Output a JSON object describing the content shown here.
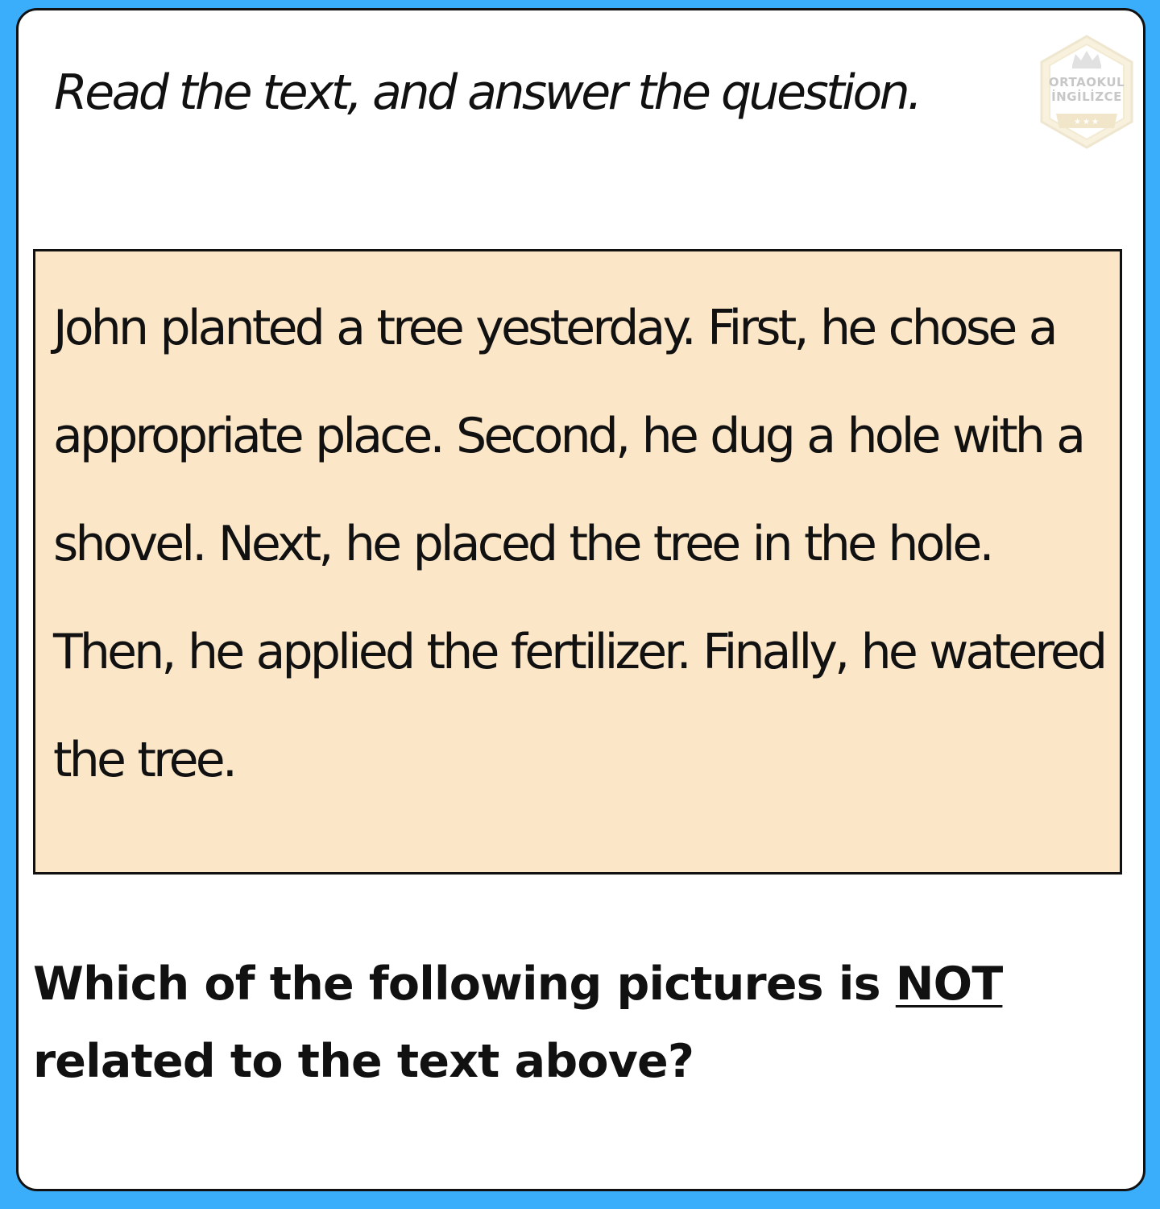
{
  "instruction": "Read the text, and answer the question.",
  "logo": {
    "line1": "ORTAOKUL",
    "line2": "İNGİLİZCE",
    "icon": "crown-hexagon-logo"
  },
  "passage": "John planted a tree yesterday. First, he chose a appropriate place. Second, he dug a hole with a shovel. Next, he placed the tree in the hole. Then, he applied the fertilizer. Finally, he watered the tree.",
  "question": {
    "part1": "Which of the following pictures is",
    "emphasis": "NOT",
    "part2": "related to the text above?"
  },
  "colors": {
    "page_background": "#3aaefb",
    "card_background": "#ffffff",
    "passage_background": "#fbe6c8",
    "text": "#111111"
  }
}
